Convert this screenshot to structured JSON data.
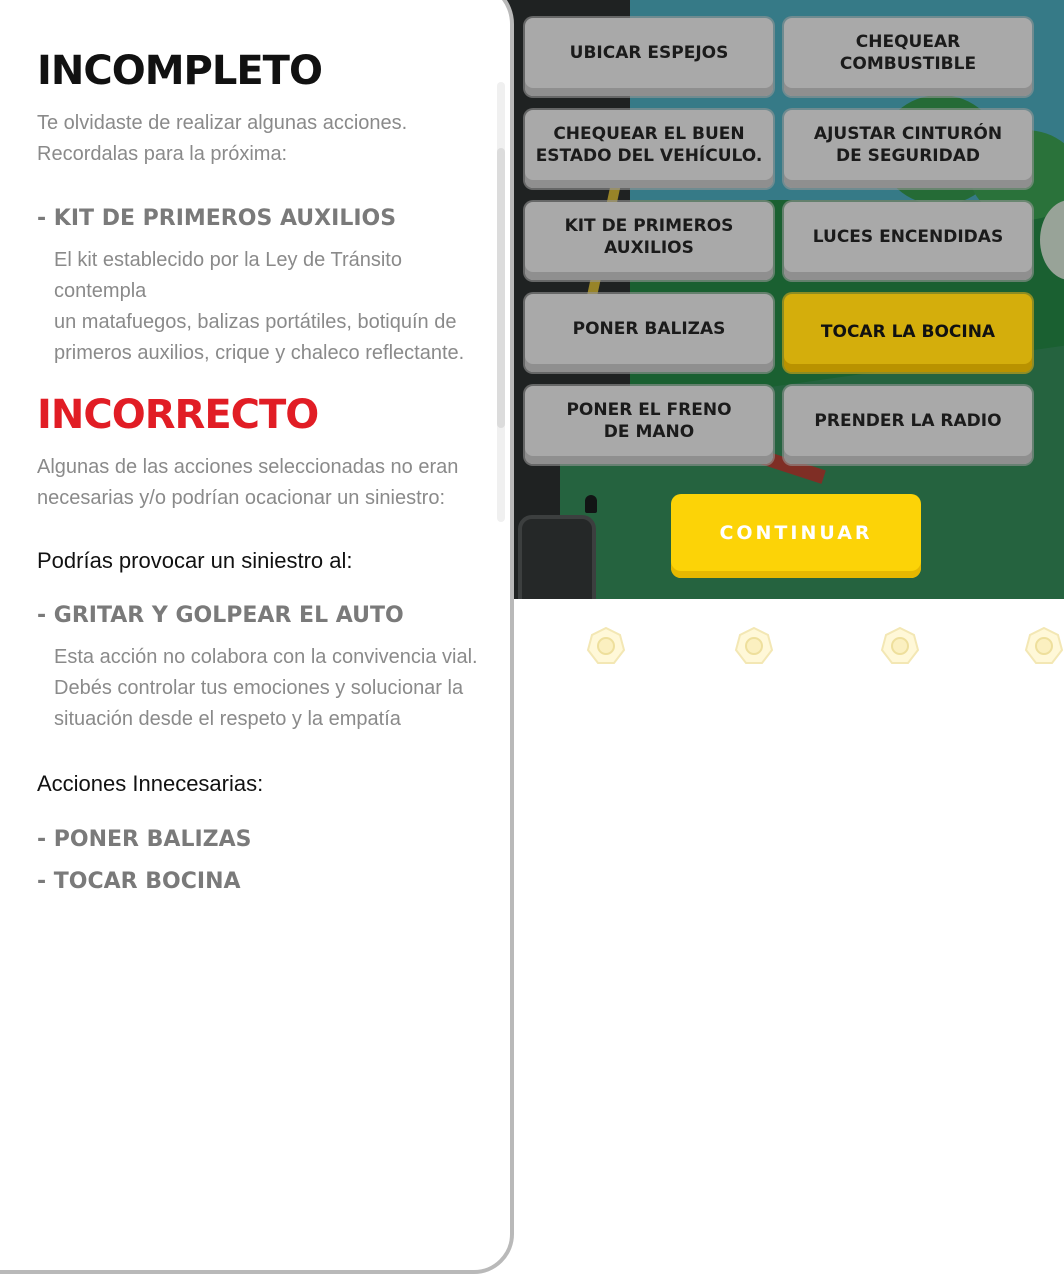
{
  "feedback": {
    "incomplete": {
      "title": "INCOMPLETO",
      "intro": "Te olvidaste de realizar algunas acciones.\nRecordalas para la próxima:",
      "items": [
        {
          "title": "- KIT DE PRIMEROS AUXILIOS",
          "desc": "El kit establecido por la Ley de Tránsito contempla\nun matafuegos, balizas portátiles, botiquín de\nprimeros auxilios, crique y chaleco reflectante."
        }
      ]
    },
    "incorrect": {
      "title": "INCORRECTO",
      "intro": "Algunas de las acciones seleccionadas no eran\nnecesarias y/o podrían ocacionar un siniestro:",
      "danger_heading": "Podrías provocar un siniestro al:",
      "danger_items": [
        {
          "title": "- GRITAR Y GOLPEAR EL AUTO",
          "desc": "Esta acción no colabora con la convivencia vial.\nDebés controlar tus emociones y solucionar la\nsituación desde el respeto y la empatía"
        }
      ],
      "unnecessary_heading": "Acciones Innecesarias:",
      "unnecessary_items": [
        "- PONER BALIZAS",
        "- TOCAR BOCINA"
      ]
    }
  },
  "options": [
    {
      "label": "UBICAR ESPEJOS",
      "selected": false
    },
    {
      "label": "CHEQUEAR\nCOMBUSTIBLE",
      "selected": false
    },
    {
      "label": "CHEQUEAR EL BUEN\nESTADO DEL VEHÍCULO.",
      "selected": false
    },
    {
      "label": "AJUSTAR CINTURÓN\nDE SEGURIDAD",
      "selected": false
    },
    {
      "label": "KIT DE PRIMEROS\nAUXILIOS",
      "selected": false
    },
    {
      "label": "LUCES ENCENDIDAS",
      "selected": false
    },
    {
      "label": "PONER BALIZAS",
      "selected": false
    },
    {
      "label": "TOCAR LA BOCINA",
      "selected": true
    },
    {
      "label": "PONER EL FRENO\nDE MANO",
      "selected": false
    },
    {
      "label": "PRENDER LA RADIO",
      "selected": false
    }
  ],
  "continue_label": "CONTINUAR",
  "colors": {
    "accent_yellow": "#fcd307",
    "error_red": "#e11d25",
    "selected_option": "#d4ae0c"
  }
}
